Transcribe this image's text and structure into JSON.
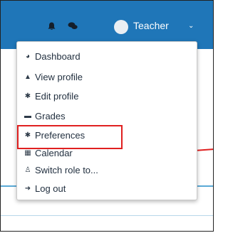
{
  "navbar": {
    "bell_icon": "bell-icon",
    "chat_icon": "chat-icon",
    "user_name": "Teacher",
    "caret": "⌄"
  },
  "menu": {
    "items": [
      {
        "label": "Dashboard",
        "icon": "dashboard-icon",
        "glyph": "◕"
      },
      {
        "label": "View profile",
        "icon": "user-icon",
        "glyph": "▲"
      },
      {
        "label": "Edit profile",
        "icon": "cog-icon",
        "glyph": "✱"
      },
      {
        "label": "Grades",
        "icon": "grades-icon",
        "glyph": "▬"
      },
      {
        "label": "Preferences",
        "icon": "cog-icon",
        "glyph": "✱"
      },
      {
        "label": "Calendar",
        "icon": "calendar-icon",
        "glyph": "▦"
      },
      {
        "label": "Switch role to...",
        "icon": "user-outline-icon",
        "glyph": "♙"
      },
      {
        "label": "Log out",
        "icon": "logout-icon",
        "glyph": "➜"
      }
    ]
  },
  "colors": {
    "navbar": "#1f76b8",
    "highlight": "#e02020"
  }
}
